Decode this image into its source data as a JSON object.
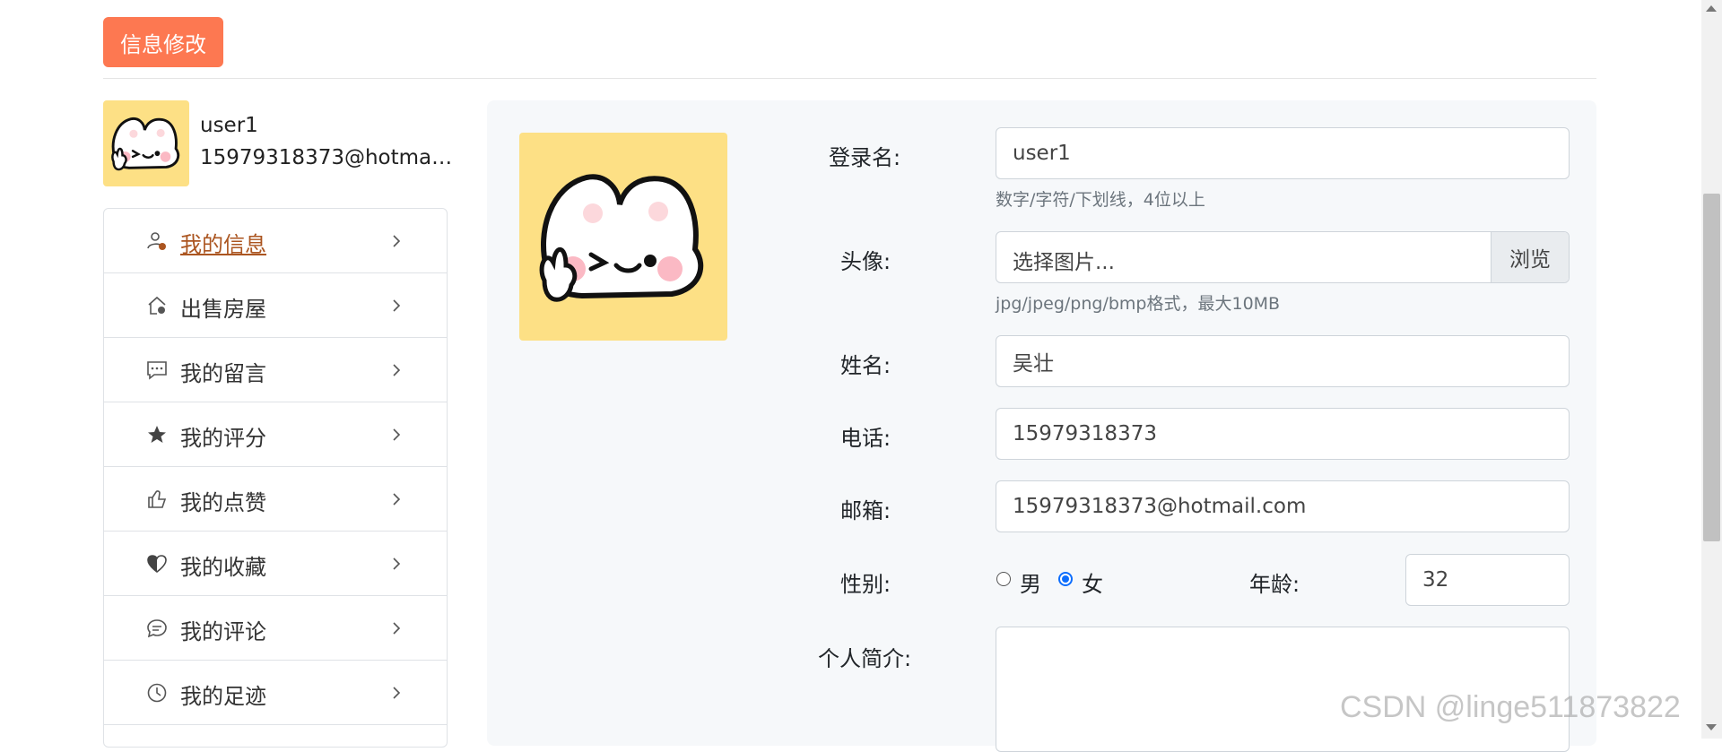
{
  "header": {
    "edit_info_button": "信息修改"
  },
  "user": {
    "name": "user1",
    "email": "15979318373@hotmail.com"
  },
  "menu": {
    "items": [
      {
        "label": "我的信息",
        "icon": "person-icon",
        "active": true
      },
      {
        "label": "出售房屋",
        "icon": "house-icon",
        "active": false
      },
      {
        "label": "我的留言",
        "icon": "message-icon",
        "active": false
      },
      {
        "label": "我的评分",
        "icon": "star-icon",
        "active": false
      },
      {
        "label": "我的点赞",
        "icon": "thumb-up-icon",
        "active": false
      },
      {
        "label": "我的收藏",
        "icon": "heart-icon",
        "active": false
      },
      {
        "label": "我的评论",
        "icon": "comment-icon",
        "active": false
      },
      {
        "label": "我的足迹",
        "icon": "clock-icon",
        "active": false
      }
    ]
  },
  "form": {
    "login_label": "登录名:",
    "login_value": "user1",
    "login_hint": "数字/字符/下划线，4位以上",
    "avatar_label": "头像:",
    "avatar_placeholder": "选择图片...",
    "browse_label": "浏览",
    "avatar_hint": "jpg/jpeg/png/bmp格式，最大10MB",
    "name_label": "姓名:",
    "name_value": "吴壮",
    "phone_label": "电话:",
    "phone_value": "15979318373",
    "email_label": "邮箱:",
    "email_value": "15979318373@hotmail.com",
    "gender_label": "性别:",
    "gender_male": "男",
    "gender_female": "女",
    "gender_selected": "女",
    "age_label": "年龄:",
    "age_value": "32",
    "bio_label": "个人简介:",
    "bio_value": ""
  },
  "watermark": "CSDN @linge511873822",
  "colors": {
    "accent": "#fd7851",
    "active_link": "#ab5520",
    "avatar_bg": "#fde085",
    "radio_checked": "#0d6efd"
  }
}
